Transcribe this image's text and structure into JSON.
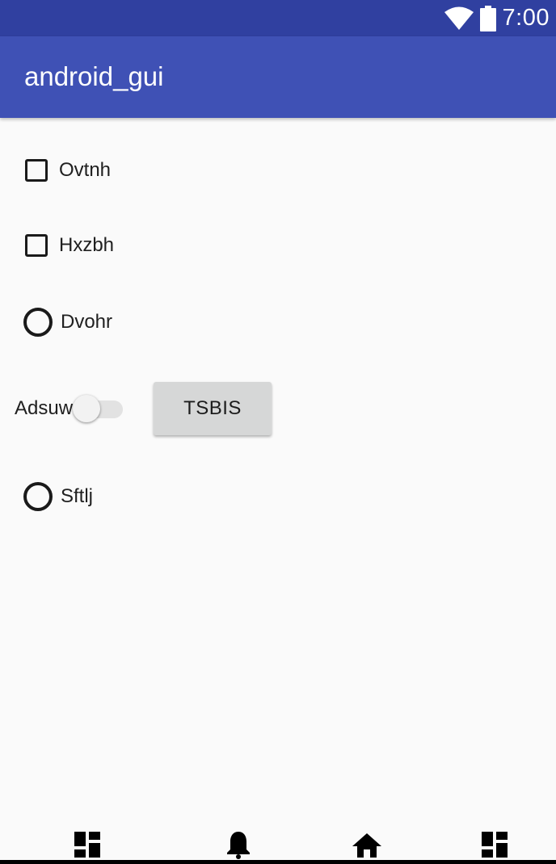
{
  "status_bar": {
    "time": "7:00",
    "wifi_icon": "wifi-icon",
    "battery_icon": "battery-icon",
    "background_color": "#3040a0"
  },
  "app_bar": {
    "title": "android_gui",
    "background_color": "#3f51b5"
  },
  "controls": {
    "checkbox_1": {
      "label": "Ovtnh",
      "checked": false
    },
    "checkbox_2": {
      "label": "Hxzbh",
      "checked": false
    },
    "radio_1": {
      "label": "Dvohr",
      "selected": false
    },
    "switch_1": {
      "label": "Adsuw",
      "on": false
    },
    "button_1": {
      "label": "TSBIS"
    },
    "radio_2": {
      "label": "Sftlj",
      "selected": false
    }
  },
  "bottom_nav": {
    "items": [
      {
        "icon": "dashboard-icon"
      },
      {
        "icon": "bell-icon"
      },
      {
        "icon": "home-icon"
      },
      {
        "icon": "dashboard-icon"
      }
    ]
  }
}
